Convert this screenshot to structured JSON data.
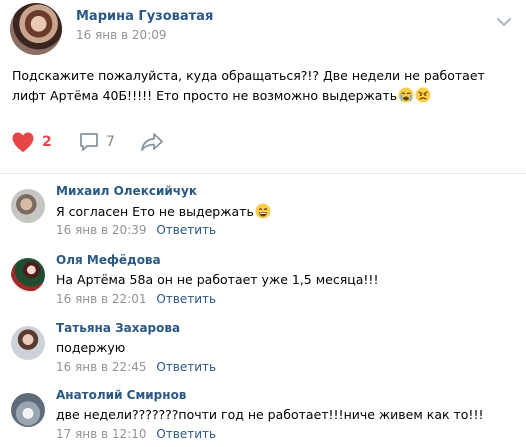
{
  "post": {
    "author": "Марина Гузоватая",
    "date": "16 янв в 20:09",
    "text": "Подскажите пожалуйста, куда обращаться?!? Две недели не работает лифт Артёма 40Б!!!!! Ето просто не возможно выдержать",
    "text_emojis": [
      "crying-face",
      "angry-face"
    ]
  },
  "actions": {
    "likes": "2",
    "comments": "7"
  },
  "comments": [
    {
      "author": "Михаил Олексийчук",
      "text": "Я согласен Ето не выдержать",
      "emoji": "grinning-face",
      "date": "16 янв в 20:39",
      "reply": "Ответить"
    },
    {
      "author": "Оля Мефёдова",
      "text": "На Артёма 58а он не работает уже 1,5 месяца!!!",
      "date": "16 янв в 22:01",
      "reply": "Ответить"
    },
    {
      "author": "Татьяна Захарова",
      "text": "подержую",
      "date": "16 янв в 22:45",
      "reply": "Ответить"
    },
    {
      "author": "Анатолий Смирнов",
      "text": "две недели???????почти год не работает!!!ниче живем как то!!!",
      "date": "17 янв в 12:10",
      "reply": "Ответить"
    }
  ],
  "colors": {
    "link": "#2a5885",
    "muted": "#939393",
    "like": "#e64646",
    "divider": "#e7e8ec"
  },
  "icons": [
    "menu-chevron-icon",
    "heart-icon",
    "comment-icon",
    "share-icon"
  ]
}
